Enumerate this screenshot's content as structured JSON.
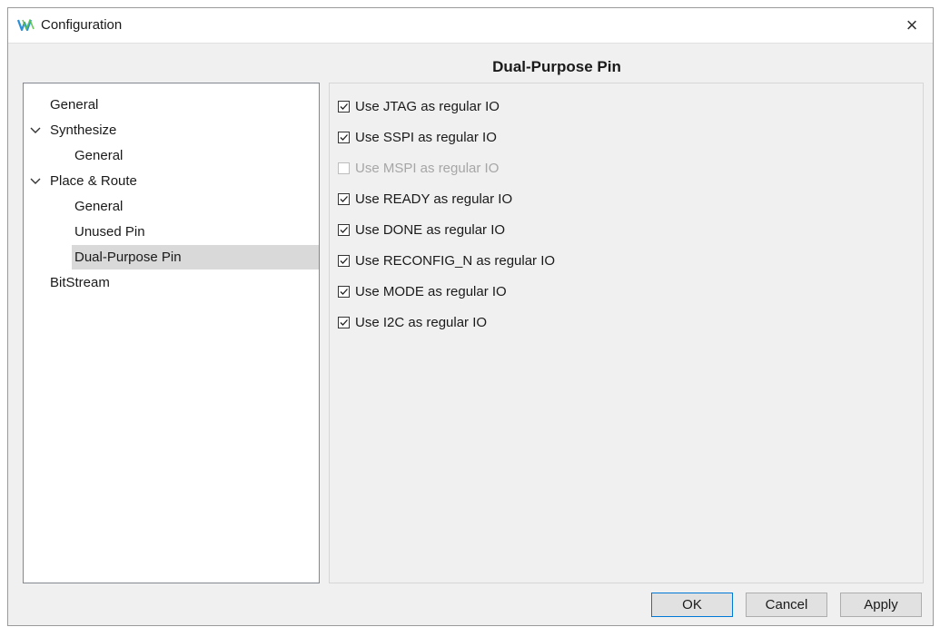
{
  "window": {
    "title": "Configuration",
    "close_glyph": "×",
    "app_icon": "gowin-logo-icon",
    "accent": "#0078d7"
  },
  "page": {
    "header": "Dual-Purpose Pin"
  },
  "tree": {
    "items": [
      {
        "label": "General",
        "level": 0,
        "expander": false,
        "selected": false
      },
      {
        "label": "Synthesize",
        "level": 0,
        "expander": true,
        "selected": false
      },
      {
        "label": "General",
        "level": 1,
        "expander": false,
        "selected": false
      },
      {
        "label": "Place & Route",
        "level": 0,
        "expander": true,
        "selected": false
      },
      {
        "label": "General",
        "level": 1,
        "expander": false,
        "selected": false
      },
      {
        "label": "Unused Pin",
        "level": 1,
        "expander": false,
        "selected": false
      },
      {
        "label": "Dual-Purpose Pin",
        "level": 1,
        "expander": false,
        "selected": true
      },
      {
        "label": "BitStream",
        "level": 0,
        "expander": false,
        "selected": false
      }
    ]
  },
  "options": [
    {
      "label": "Use JTAG as regular IO",
      "checked": true,
      "enabled": true
    },
    {
      "label": "Use SSPI as regular IO",
      "checked": true,
      "enabled": true
    },
    {
      "label": "Use MSPI as regular IO",
      "checked": false,
      "enabled": false
    },
    {
      "label": "Use READY as regular IO",
      "checked": true,
      "enabled": true
    },
    {
      "label": "Use DONE as regular IO",
      "checked": true,
      "enabled": true
    },
    {
      "label": "Use RECONFIG_N as regular IO",
      "checked": true,
      "enabled": true
    },
    {
      "label": "Use MODE as regular IO",
      "checked": true,
      "enabled": true
    },
    {
      "label": "Use I2C as regular IO",
      "checked": true,
      "enabled": true
    }
  ],
  "buttons": {
    "ok": "OK",
    "cancel": "Cancel",
    "apply": "Apply"
  }
}
